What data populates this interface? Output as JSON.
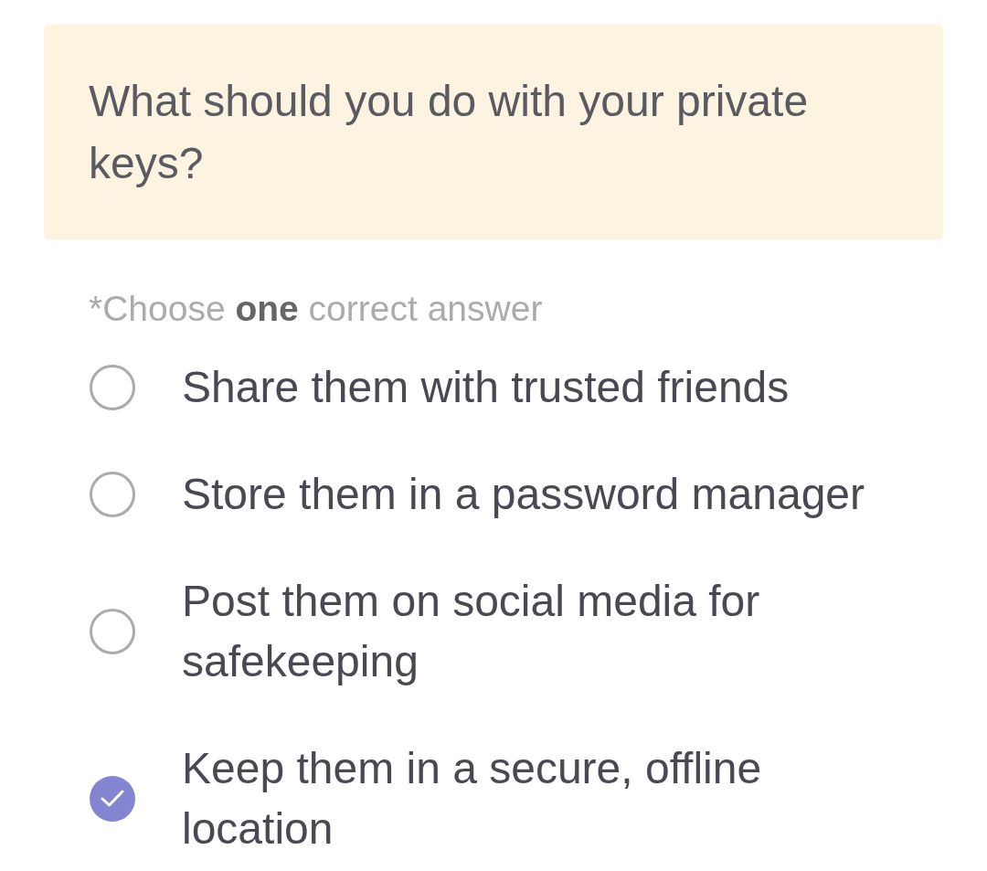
{
  "question": {
    "text": "What should you do with your private keys?"
  },
  "instruction": "*Choose **one** correct answer",
  "options": [
    {
      "label": "Share them with trusted friends",
      "selected": false
    },
    {
      "label": "Store them in a password manager",
      "selected": false
    },
    {
      "label": "Post them on social media for safekeeping",
      "selected": false
    },
    {
      "label": "Keep them in a secure, offline location",
      "selected": true
    }
  ]
}
